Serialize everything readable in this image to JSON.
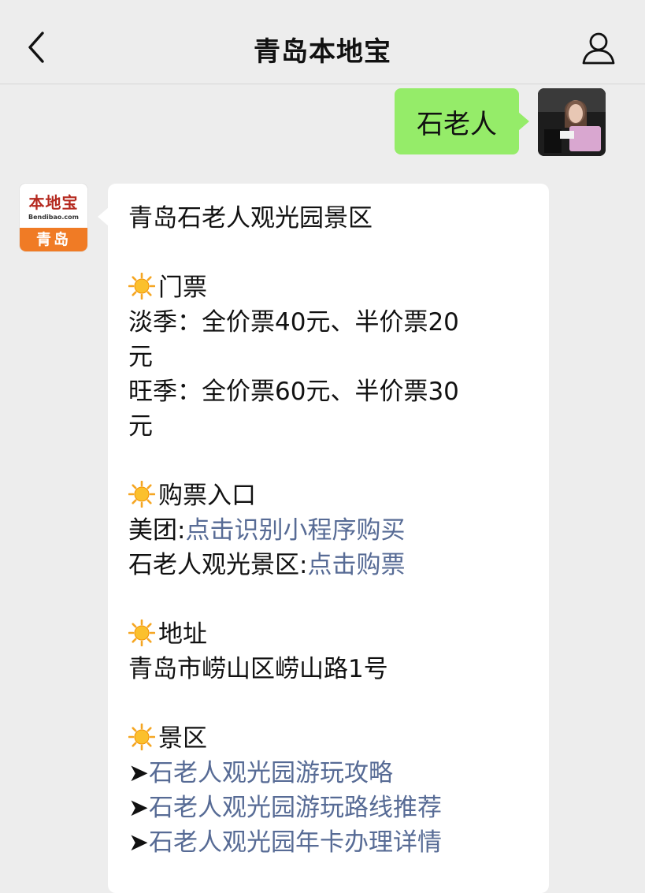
{
  "nav": {
    "title": "青岛本地宝",
    "back_icon": "chevron-left-icon",
    "profile_icon": "person-icon"
  },
  "user_message": {
    "text": "石老人",
    "bubble_color": "#95ec69"
  },
  "bot": {
    "avatar": {
      "logo_main": "本地宝",
      "logo_sub": "Bendibao.com",
      "logo_city": "青岛",
      "brand_color": "#f07b25"
    },
    "message": {
      "title": "青岛石老人观光园景区",
      "tickets": {
        "heading": "门票",
        "offseason_line1": "淡季：全价票40元、半价票20",
        "offseason_line2": "元",
        "peakseason_line1": "旺季：全价票60元、半价票30",
        "peakseason_line2": "元"
      },
      "purchase": {
        "heading": "购票入口",
        "meituan_label": "美团:",
        "meituan_link": "点击识别小程序购买",
        "scenic_label": "石老人观光景区:",
        "scenic_link": "点击购票"
      },
      "address": {
        "heading": "地址",
        "text": "青岛市崂山区崂山路1号"
      },
      "scenic": {
        "heading": "景区",
        "links": [
          {
            "arrow": "➤",
            "text": "石老人观光园游玩攻略"
          },
          {
            "arrow": "➤",
            "text": "石老人观光园游玩路线推荐"
          },
          {
            "arrow": "➤",
            "text": "石老人观光园年卡办理详情"
          }
        ]
      },
      "heading_icon": "sun-icon",
      "link_color": "#576b95"
    }
  }
}
